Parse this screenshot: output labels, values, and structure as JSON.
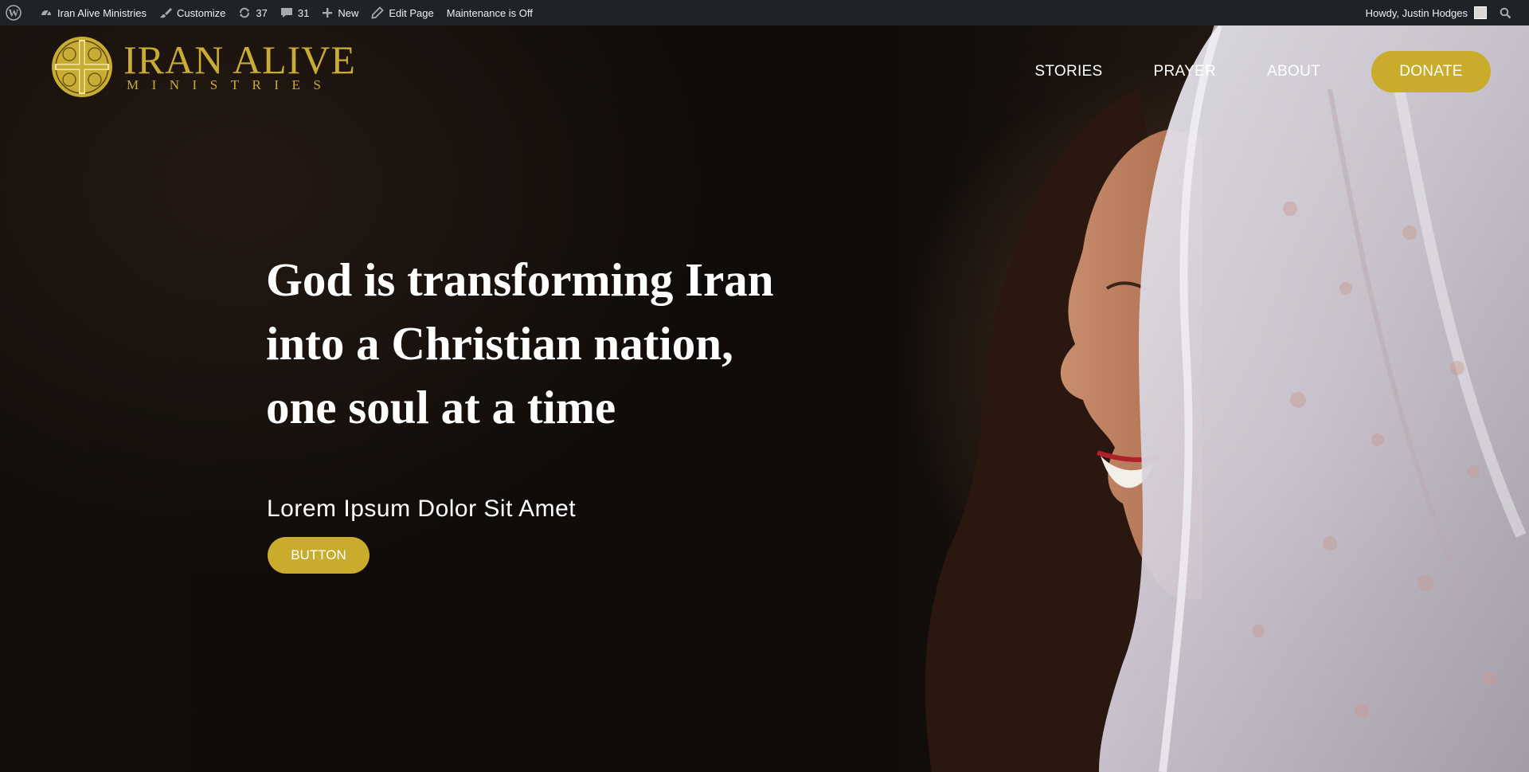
{
  "admin_bar": {
    "site_name": "Iran Alive Ministries",
    "customize": "Customize",
    "updates_count": "37",
    "comments_count": "31",
    "new_label": "New",
    "edit_page": "Edit Page",
    "maintenance": "Maintenance is Off",
    "howdy": "Howdy, Justin Hodges",
    "icons": [
      "wordpress-logo-icon",
      "dashboard-icon",
      "brush-icon",
      "updates-icon",
      "comment-icon",
      "plus-icon",
      "pencil-icon",
      "search-icon"
    ]
  },
  "header": {
    "logo_line1": "IRAN ALIVE",
    "logo_line2": "MINISTRIES",
    "nav": [
      "STORIES",
      "PRAYER",
      "ABOUT"
    ],
    "donate": "DONATE"
  },
  "hero": {
    "headline": [
      "God is transforming Iran",
      "into a Christian nation,",
      "one soul at a time"
    ],
    "subhead": "Lorem Ipsum Dolor Sit Amet",
    "button": "BUTTON"
  },
  "colors": {
    "admin_bar": "#1d2327",
    "gold": "#c9ac2c",
    "hero_bg": "#0f0b09",
    "text": "#ffffff"
  }
}
